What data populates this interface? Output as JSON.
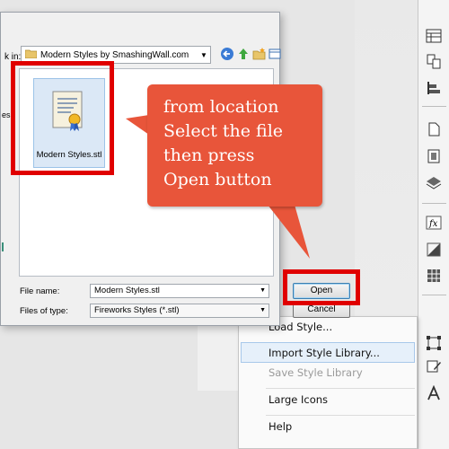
{
  "dialog": {
    "look_in_label": "k in:",
    "path": "Modern Styles by SmashingWall.com",
    "side_label": "es",
    "file": {
      "name": "Modern Styles.stl",
      "icon": "certificate-document-icon"
    },
    "file_name_label": "File name:",
    "file_name_value": "Modern Styles.stl",
    "files_of_type_label": "Files of type:",
    "files_of_type_value": "Fireworks Styles (*.stl)",
    "open_label": "Open",
    "cancel_label": "Cancel"
  },
  "callout": {
    "lines": [
      "from location",
      "Select the file",
      "then press",
      "Open button"
    ],
    "color": "#e8553a"
  },
  "context_menu": {
    "items": [
      {
        "label": "Load Style...",
        "state": "normal"
      },
      {
        "label": "Import Style Library...",
        "state": "highlighted"
      },
      {
        "label": "Save Style Library",
        "state": "disabled"
      },
      {
        "label": "Large Icons",
        "state": "normal"
      },
      {
        "label": "Help",
        "state": "normal"
      }
    ]
  },
  "annotation_color": "#e00000"
}
